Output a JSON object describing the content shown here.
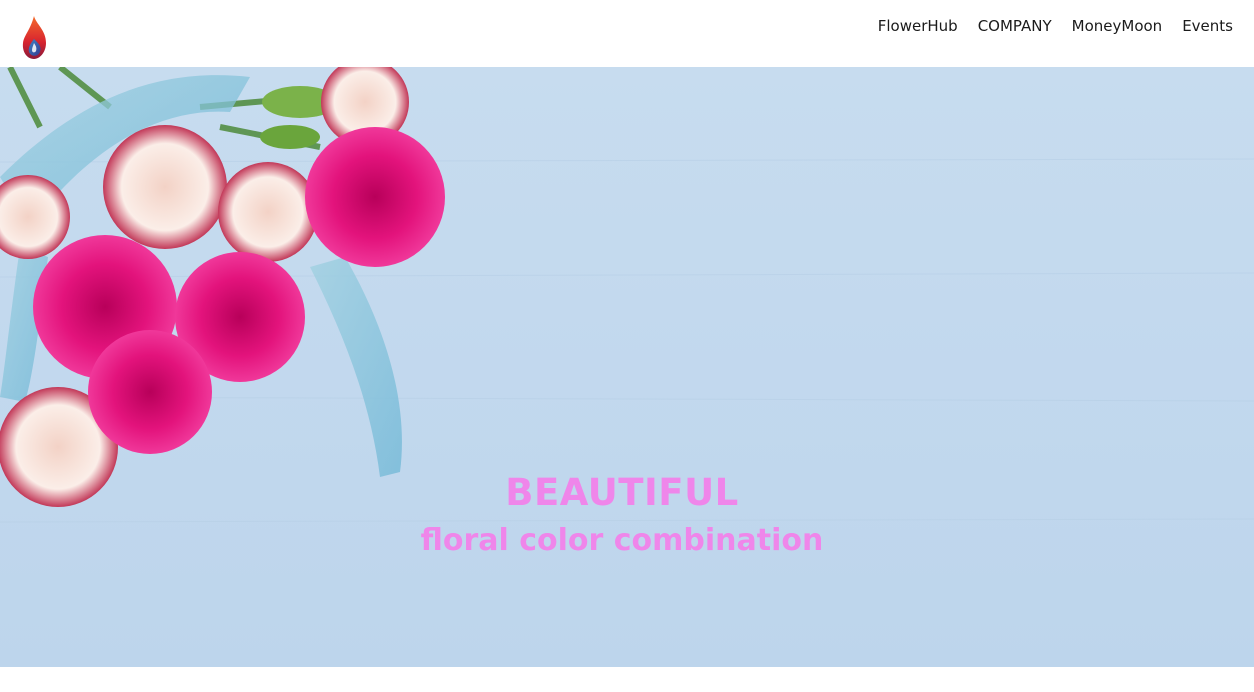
{
  "header": {
    "logo_icon": "flame-logo-icon",
    "nav": [
      {
        "label": "FlowerHub"
      },
      {
        "label": "COMPANY"
      },
      {
        "label": "MoneyMoon"
      },
      {
        "label": "Events"
      }
    ]
  },
  "hero": {
    "title": "BEAUTIFUL",
    "subtitle": "floral color combination",
    "text_color": "#ef86ea",
    "background_color": "#c3d9ee"
  }
}
